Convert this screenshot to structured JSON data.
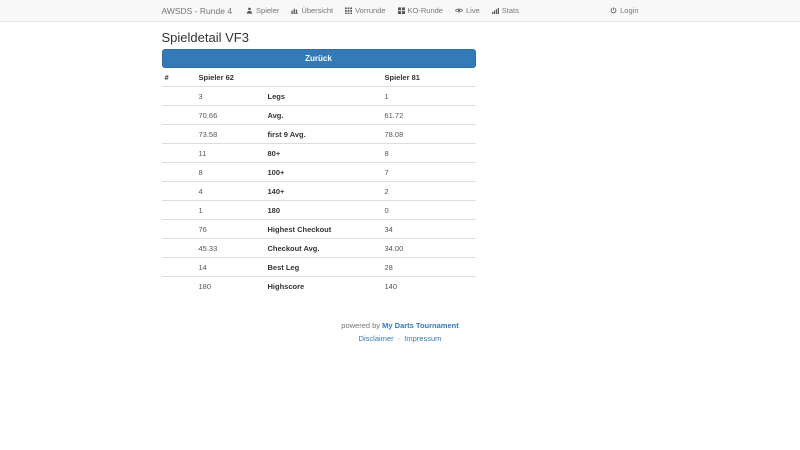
{
  "navbar": {
    "brand": "AWSDS - Runde 4",
    "items": [
      {
        "label": "Spieler",
        "icon": "user-icon"
      },
      {
        "label": "Übersicht",
        "icon": "bar-chart-icon"
      },
      {
        "label": "Vorrunde",
        "icon": "grid-icon"
      },
      {
        "label": "KO-Runde",
        "icon": "grid-large-icon"
      },
      {
        "label": "Live",
        "icon": "eye-icon"
      },
      {
        "label": "Stats",
        "icon": "signal-icon"
      }
    ],
    "login_label": "Login"
  },
  "page": {
    "title": "Spieldetail VF3",
    "back_button_label": "Zurück"
  },
  "table": {
    "headers": {
      "index": "#",
      "player1": "Spieler 62",
      "stat": "",
      "player2": "Spieler 81"
    },
    "rows": [
      {
        "p1": "3",
        "label": "Legs",
        "p2": "1"
      },
      {
        "p1": "70.66",
        "label": "Avg.",
        "p2": "61.72"
      },
      {
        "p1": "73.58",
        "label": "first 9 Avg.",
        "p2": "78.08"
      },
      {
        "p1": "11",
        "label": "80+",
        "p2": "8"
      },
      {
        "p1": "8",
        "label": "100+",
        "p2": "7"
      },
      {
        "p1": "4",
        "label": "140+",
        "p2": "2"
      },
      {
        "p1": "1",
        "label": "180",
        "p2": "0"
      },
      {
        "p1": "76",
        "label": "Highest Checkout",
        "p2": "34"
      },
      {
        "p1": "45.33",
        "label": "Checkout Avg.",
        "p2": "34.00"
      },
      {
        "p1": "14",
        "label": "Best Leg",
        "p2": "28"
      },
      {
        "p1": "180",
        "label": "Highscore",
        "p2": "140"
      }
    ]
  },
  "footer": {
    "powered_by_prefix": "powered by",
    "brand_link": "My Darts Tournament",
    "disclaimer_link": "Disclaimer",
    "impressum_link": "Impressum",
    "separator": "·"
  },
  "colors": {
    "primary": "#337ab7",
    "navbar_bg": "#f8f8f8",
    "navbar_border": "#e7e7e7",
    "muted_text": "#777777",
    "table_border": "#dddddd"
  }
}
